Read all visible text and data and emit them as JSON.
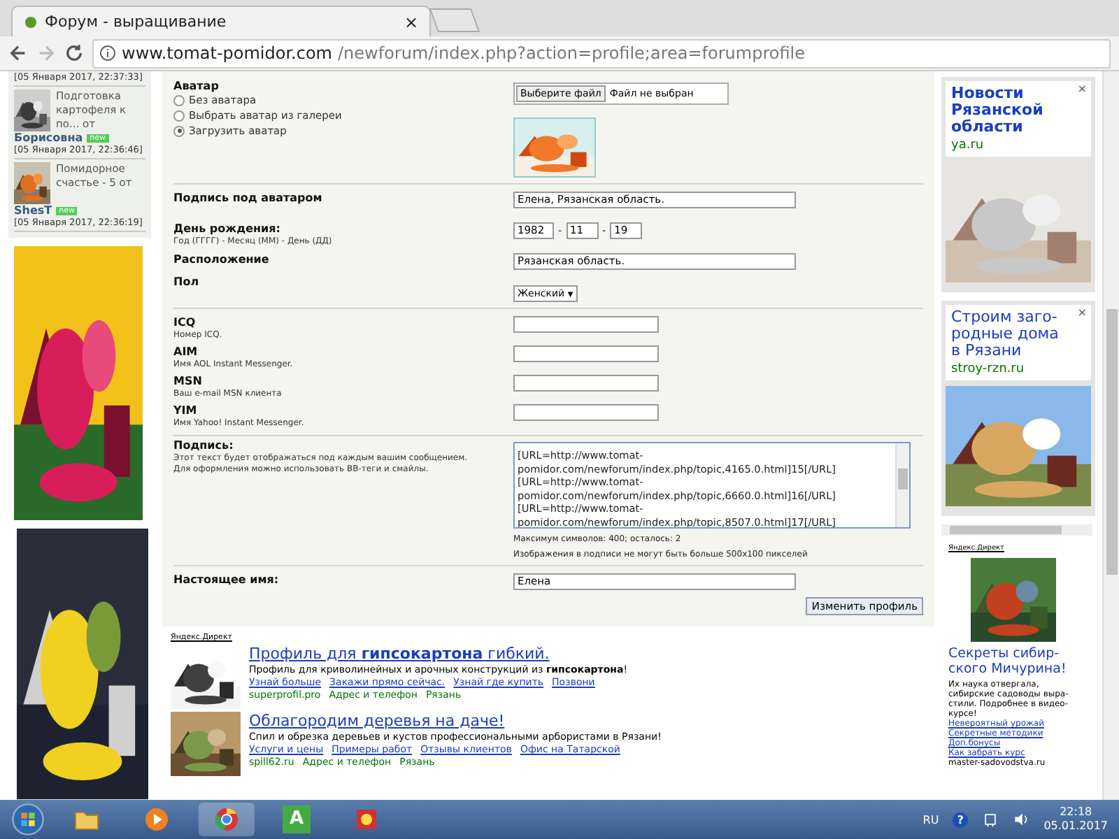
{
  "browser": {
    "tab_title": "Форум - выращивание",
    "tab_close": "×",
    "url_domain": "www.tomat-pomidor.com",
    "url_path": "/newforum/index.php?action=profile;area=forumprofile"
  },
  "recent_posts": [
    {
      "date": "[05 Января 2017, 22:37:33]",
      "kind": "cut"
    },
    {
      "title": "Подготовка картофеля к по... от",
      "author": "Борисовна",
      "badge": "new",
      "date": "[05 Января 2017, 22:36:46]",
      "kind": "post"
    },
    {
      "title": "Помидорное счастье - 5 от",
      "author": "ShesT",
      "badge": "new",
      "date": "[05 Января 2017, 22:36:19]",
      "kind": "post"
    }
  ],
  "avatar": {
    "label": "Аватар",
    "options": [
      {
        "label": "Без аватара",
        "selected": false
      },
      {
        "label": "Выбрать аватар из галереи",
        "selected": false
      },
      {
        "label": "Загрузить аватар",
        "selected": true
      }
    ],
    "file_button": "Выберите файл",
    "file_status": "Файл не выбран"
  },
  "rows": [
    {
      "kind": "text",
      "label": "Подпись под аватаром",
      "value": "Елена, Рязанская область."
    },
    {
      "kind": "date",
      "label": "День рождения:",
      "hint": "Год (ГГГГ) - Месяц (ММ) - День (ДД)",
      "year": "1982",
      "month": "11",
      "day": "19",
      "separator": "-"
    },
    {
      "kind": "text",
      "label": "Расположение",
      "value": "Рязанская область."
    },
    {
      "kind": "select",
      "label": "Пол",
      "value": "Женский",
      "arrow": "▼"
    }
  ],
  "messengers": [
    {
      "label": "ICQ",
      "hint": "Номер ICQ."
    },
    {
      "label": "AIM",
      "hint": "Имя AOL Instant Messenger."
    },
    {
      "label": "MSN",
      "hint": "Ваш e-mail MSN клиента"
    },
    {
      "label": "YIM",
      "hint": "Имя Yahoo! Instant Messenger."
    }
  ],
  "signature": {
    "label": "Подпись:",
    "hints": [
      "Этот текст будет отображаться под каждым вашим сообщением.",
      "Для оформления можно использовать BB-теги и смайлы."
    ],
    "lines": [
      "[URL=http://www.tomat-",
      "pomidor.com/newforum/index.php/topic,4165.0.html]15[/URL]",
      "[URL=http://www.tomat-",
      "pomidor.com/newforum/index.php/topic,6660.0.html]16[/URL]",
      "[URL=http://www.tomat-",
      "pomidor.com/newforum/index.php/topic,8507.0.html]17[/URL]"
    ],
    "notes": [
      "Максимум символов: 400; осталось: 2",
      "Изображения в подписи не могут быть больше 500x100 пикселей"
    ]
  },
  "real_name": {
    "label": "Настоящее имя:",
    "value": "Елена"
  },
  "submit": "Изменить профиль",
  "direct_label": "Яндекс.Директ",
  "bottom_ads": [
    {
      "title": "Профиль для **гипсокартона** гибкий.",
      "text": "Профиль для криволинейных и арочных конструкций из **гипсокартона**!",
      "links": [
        "Узнай больше",
        "Закажи прямо сейчас.",
        "Узнай где купить",
        "Позвони"
      ],
      "domain": "superprofil.pro",
      "extras": [
        "Адрес и телефон",
        "Рязань"
      ]
    },
    {
      "title": "Облагородим деревья на даче!",
      "text": "Спил и обрезка деревьев и кустов профессиональными арбористами в Рязани!",
      "links": [
        "Услуги и цены",
        "Примеры работ",
        "Отзывы клиентов",
        "Офис на Татарской"
      ],
      "domain": "spill62.ru",
      "extras": [
        "Адрес и телефон",
        "Рязань"
      ]
    }
  ],
  "right_ads": [
    {
      "title": "Новости Рязанской области",
      "domain": "ya.ru",
      "close": "×"
    },
    {
      "title": "Строим заго-родные дома в Рязани",
      "domain": "stroy-rzn.ru",
      "close": "×"
    }
  ],
  "right_direct": {
    "label": "Яндекс.Директ",
    "title": "Секреты сибир-ского Мичурина!",
    "text": "Их наука отвергала, сибирские садоводы выра-стили. Подробнее в видео-курсе!",
    "links": [
      "Невероятный урожай",
      "Секретные методики",
      "Доп.бонусы",
      "Как забрать курс"
    ],
    "domain": "master-sadovodstva.ru"
  },
  "taskbar": {
    "app_letter": "А",
    "language": "RU",
    "help": "?",
    "time": "22:18",
    "date": "05.01.2017"
  }
}
